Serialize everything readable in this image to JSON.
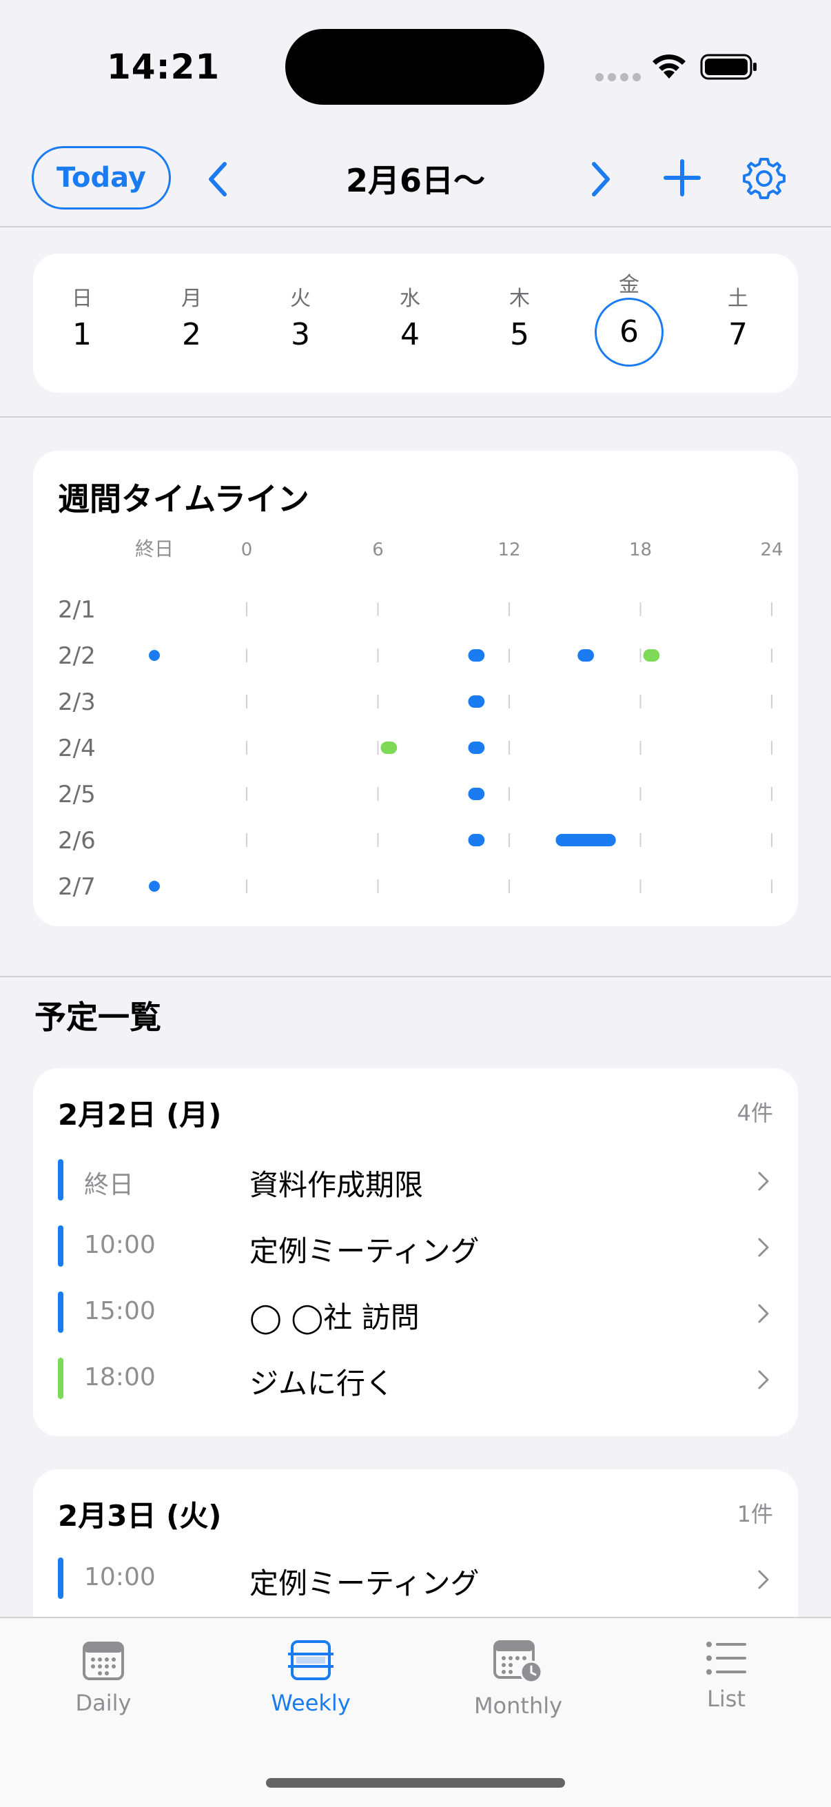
{
  "status_bar": {
    "time": "14:21"
  },
  "nav": {
    "today_label": "Today",
    "title": "2月6日〜"
  },
  "week": {
    "days": [
      {
        "weekday": "日",
        "date": "1"
      },
      {
        "weekday": "月",
        "date": "2"
      },
      {
        "weekday": "火",
        "date": "3"
      },
      {
        "weekday": "水",
        "date": "4"
      },
      {
        "weekday": "木",
        "date": "5"
      },
      {
        "weekday": "金",
        "date": "6",
        "selected": true
      },
      {
        "weekday": "土",
        "date": "7"
      }
    ]
  },
  "timeline": {
    "title": "週間タイムライン",
    "allday_label": "終日",
    "hour_ticks": [
      "0",
      "6",
      "12",
      "18",
      "24"
    ],
    "rows": [
      "2/1",
      "2/2",
      "2/3",
      "2/4",
      "2/5",
      "2/6",
      "2/7"
    ],
    "events": [
      {
        "row": 1,
        "allday": true,
        "color": "#1A7CF0"
      },
      {
        "row": 1,
        "start": 10.0,
        "end": 11.0,
        "color": "#1A7CF0"
      },
      {
        "row": 1,
        "start": 15.0,
        "end": 16.0,
        "color": "#1A7CF0"
      },
      {
        "row": 1,
        "start": 18.0,
        "end": 19.0,
        "color": "#7ED957"
      },
      {
        "row": 2,
        "start": 10.0,
        "end": 11.0,
        "color": "#1A7CF0"
      },
      {
        "row": 3,
        "start": 6.0,
        "end": 7.0,
        "color": "#7ED957"
      },
      {
        "row": 3,
        "start": 10.0,
        "end": 11.0,
        "color": "#1A7CF0"
      },
      {
        "row": 4,
        "start": 10.0,
        "end": 11.0,
        "color": "#1A7CF0"
      },
      {
        "row": 5,
        "start": 10.0,
        "end": 11.0,
        "color": "#1A7CF0"
      },
      {
        "row": 5,
        "start": 14.0,
        "end": 17.0,
        "color": "#1A7CF0"
      },
      {
        "row": 6,
        "allday": true,
        "color": "#1A7CF0"
      }
    ]
  },
  "schedule": {
    "title": "予定一覧",
    "groups": [
      {
        "date": "2月2日 (月)",
        "count": "4件",
        "items": [
          {
            "time": "終日",
            "title": "資料作成期限",
            "color": "#1A7CF0"
          },
          {
            "time": "10:00",
            "title": "定例ミーティング",
            "color": "#1A7CF0"
          },
          {
            "time": "15:00",
            "title": "◯ ◯社 訪問",
            "color": "#1A7CF0"
          },
          {
            "time": "18:00",
            "title": "ジムに行く",
            "color": "#7ED957"
          }
        ]
      },
      {
        "date": "2月3日 (火)",
        "count": "1件",
        "items": [
          {
            "time": "10:00",
            "title": "定例ミーティング",
            "color": "#1A7CF0"
          }
        ]
      }
    ]
  },
  "tabs": [
    {
      "label": "Daily",
      "icon": "calendar-day-icon"
    },
    {
      "label": "Weekly",
      "icon": "calendar-week-icon",
      "active": true
    },
    {
      "label": "Monthly",
      "icon": "calendar-clock-icon"
    },
    {
      "label": "List",
      "icon": "list-icon"
    }
  ],
  "colors": {
    "accent": "#1A7CF0",
    "green": "#7ED957",
    "background": "#F2F2F7"
  }
}
